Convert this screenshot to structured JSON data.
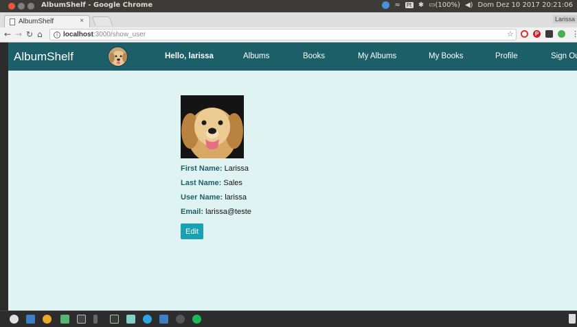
{
  "os": {
    "window_title": "AlbumShelf - Google Chrome",
    "tray_pt": "Pt",
    "battery": "(100%)",
    "clock": "Dom Dez 10 2017 20:21:06"
  },
  "browser": {
    "tab_label": "AlbumShelf",
    "tab_close": "×",
    "profile": "Larissa",
    "url_host": "localhost",
    "url_path": ":3000/show_user"
  },
  "app": {
    "brand": "AlbumShelf",
    "nav": {
      "hello": "Hello, larissa",
      "albums": "Albums",
      "books": "Books",
      "my_albums": "My Albums",
      "my_books": "My Books",
      "profile": "Profile",
      "sign_out": "Sign Out"
    },
    "user": {
      "first_name_label": "First Name:",
      "first_name": "Larissa",
      "last_name_label": "Last Name:",
      "last_name": "Sales",
      "user_name_label": "User Name:",
      "user_name": "larissa",
      "email_label": "Email:",
      "email": "larissa@teste"
    },
    "edit_label": "Edit"
  },
  "colors": {
    "navbar": "#1c5f68",
    "page_bg": "#dff4f2",
    "button": "#1aa0b2"
  }
}
